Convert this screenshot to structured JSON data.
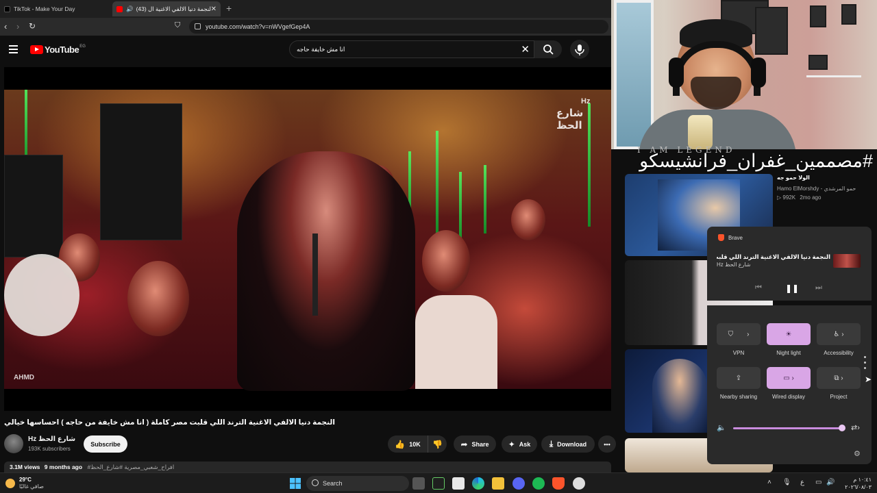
{
  "browser": {
    "tabs": [
      {
        "label": "TikTok - Make Your Day",
        "active": false
      },
      {
        "label": "(43) النجمة دنيا الالفي الاغنية ال...",
        "active": true
      }
    ],
    "new_tab": "+",
    "url": "youtube.com/watch?v=nWVgefGep4A"
  },
  "youtube": {
    "logo": "YouTube",
    "region": "EG",
    "search_query": "انا مش خايفة حاجه"
  },
  "video": {
    "watermark_badge": "Hz",
    "watermark_text": "شارع الحظ",
    "corner_logo": "AHMD",
    "title": "النجمة دنيا الالفي الاغنية الترند اللي قلبت مصر كاملة ( انا مش خايفة من حاجه ) احساسها خيالي",
    "channel_name": "Hz شارع الحظ",
    "subscribers": "193K subscribers",
    "subscribe_label": "Subscribe",
    "likes": "10K",
    "share_label": "Share",
    "ask_label": "Ask",
    "download_label": "Download",
    "views": "3.1M views",
    "age": "9 months ago",
    "hashtags": "#افراح_شعبي_مصرية #شارع_الحظ"
  },
  "overlay": {
    "hashtag": "#مصممين_غفران_فرانشيسكو",
    "legend_text": "I AM LEGEND"
  },
  "recommendations": [
    {
      "title": "الولا حمو جه",
      "channel": "Hamo ElMorshdy - حمو المرشدي",
      "views": "992K",
      "age": "2mo ago"
    }
  ],
  "media_flyout": {
    "app": "Brave",
    "title": "النجمة دنيا الالفي الاغنية الترند اللي قلبت...",
    "artist": "Hz شارع الحظ"
  },
  "quick_settings": {
    "tiles": [
      {
        "label": "VPN",
        "on": false
      },
      {
        "label": "Night light",
        "on": true
      },
      {
        "label": "Accessibility",
        "on": false
      },
      {
        "label": "Nearby sharing",
        "on": false
      },
      {
        "label": "Wired display",
        "on": true
      },
      {
        "label": "Project",
        "on": false
      }
    ],
    "volume": 0.95
  },
  "taskbar": {
    "temp": "29°C",
    "condition": "صافي غالبًا",
    "search_label": "Search",
    "lang": "ع",
    "time": "١٠:٤١ م",
    "date": "٢٠٢٦/٠٨/٠٣"
  },
  "colors": {
    "accent": "#d9a6e6",
    "yt_red": "#ff0000"
  }
}
